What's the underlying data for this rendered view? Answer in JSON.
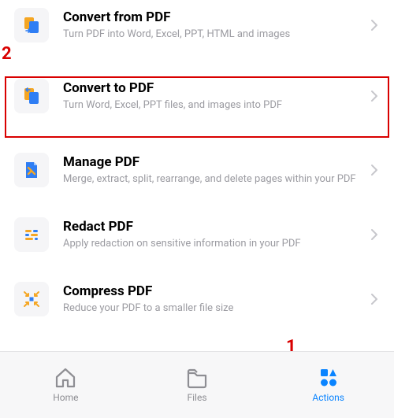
{
  "actions": [
    {
      "id": "convert-from-pdf",
      "title": "Convert from PDF",
      "subtitle": "Turn PDF into Word, Excel, PPT, HTML and images"
    },
    {
      "id": "convert-to-pdf",
      "title": "Convert to PDF",
      "subtitle": "Turn Word, Excel, PPT files, and images into PDF"
    },
    {
      "id": "manage-pdf",
      "title": "Manage PDF",
      "subtitle": "Merge, extract, split, rearrange, and delete pages within your PDF"
    },
    {
      "id": "redact-pdf",
      "title": "Redact PDF",
      "subtitle": "Apply redaction on sensitive information in your PDF"
    },
    {
      "id": "compress-pdf",
      "title": "Compress PDF",
      "subtitle": "Reduce your PDF to a smaller file size"
    }
  ],
  "tabs": {
    "home": {
      "label": "Home",
      "active": false
    },
    "files": {
      "label": "Files",
      "active": false
    },
    "actions": {
      "label": "Actions",
      "active": true
    }
  },
  "annotations": {
    "callout1": "1",
    "callout2": "2"
  },
  "colors": {
    "accent": "#0a84ff",
    "annotation": "#d90000",
    "orange": "#f5a623",
    "blue": "#2f7ef4"
  }
}
